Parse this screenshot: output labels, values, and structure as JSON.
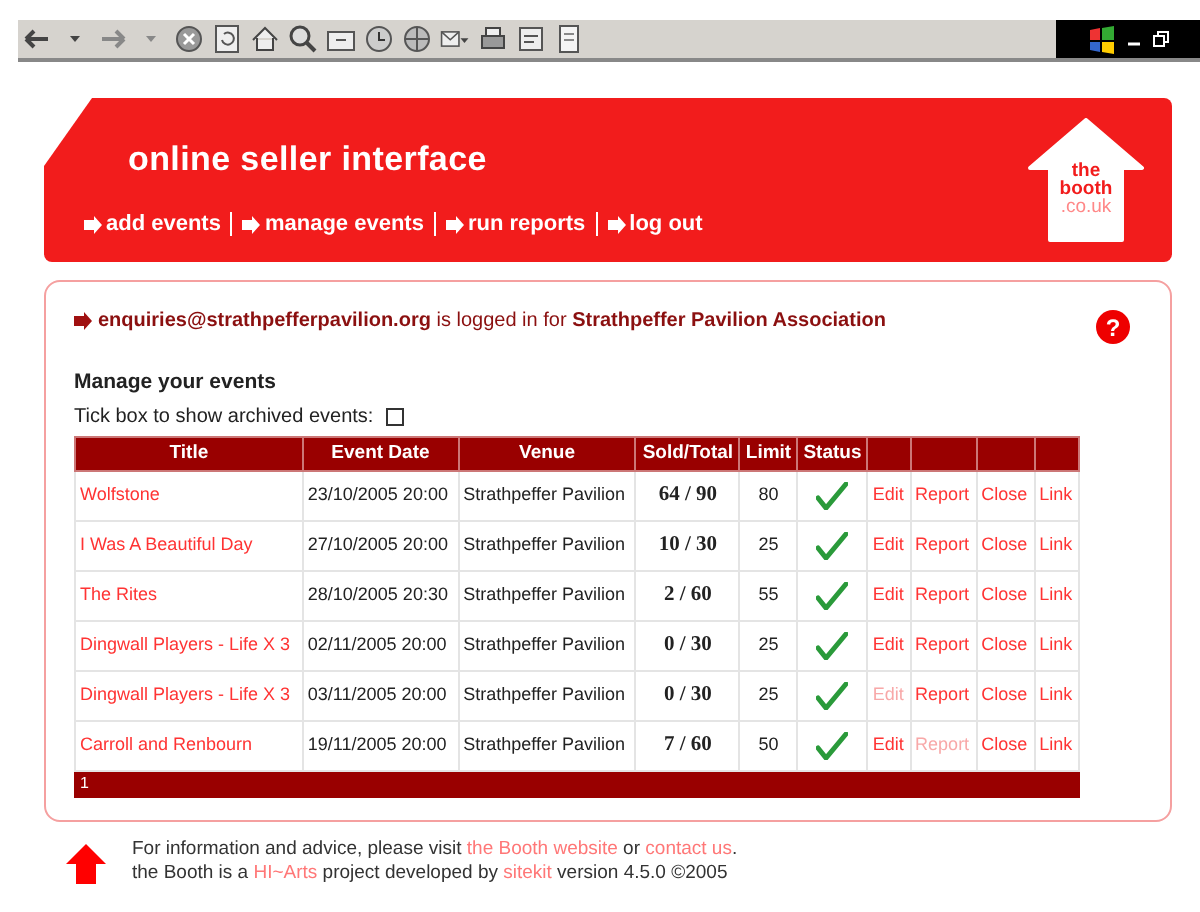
{
  "toolbar": {
    "buttons": [
      {
        "kind": "back"
      },
      {
        "kind": "back-menu"
      },
      {
        "kind": "forward"
      },
      {
        "kind": "forward-menu"
      },
      {
        "kind": "stop"
      },
      {
        "kind": "refresh"
      },
      {
        "kind": "home"
      },
      {
        "kind": "search"
      },
      {
        "kind": "favorites"
      },
      {
        "kind": "history"
      },
      {
        "kind": "media"
      },
      {
        "kind": "mail"
      },
      {
        "kind": "print"
      },
      {
        "kind": "edit"
      },
      {
        "kind": "discuss"
      }
    ]
  },
  "header": {
    "title": "online seller interface",
    "nav": [
      {
        "label": "add events"
      },
      {
        "label": "manage events"
      },
      {
        "label": "run reports"
      },
      {
        "label": "log out"
      }
    ],
    "logo": [
      "the",
      "booth",
      ".co.uk"
    ]
  },
  "login": {
    "text": "**enquiries@strathpefferpavilion.org** is logged in for **Strathpeffer Pavilion Association**",
    "help": "?"
  },
  "section": {
    "title": "Manage your events",
    "archive_label": "Tick box to show archived events:",
    "archive_checked": false
  },
  "table": {
    "columns": [
      "Title",
      "Event Date",
      "Venue",
      "Sold/Total",
      "Limit",
      "Status",
      "",
      "",
      "",
      ""
    ],
    "rows": [
      {
        "title": "Wolfstone",
        "date": "23/10/2005 20:00",
        "venue": "Strathpeffer Pavilion",
        "sold_total": "64 / 90",
        "limit": "80",
        "status_ok": true,
        "actions": [
          {
            "label": "Edit",
            "disabled": false
          },
          {
            "label": "Report",
            "disabled": false
          },
          {
            "label": "Close",
            "disabled": false
          },
          {
            "label": "Link",
            "disabled": false
          }
        ]
      },
      {
        "title": "I Was A Beautiful Day",
        "date": "27/10/2005 20:00",
        "venue": "Strathpeffer Pavilion",
        "sold_total": "10 / 30",
        "limit": "25",
        "status_ok": true,
        "actions": [
          {
            "label": "Edit",
            "disabled": false
          },
          {
            "label": "Report",
            "disabled": false
          },
          {
            "label": "Close",
            "disabled": false
          },
          {
            "label": "Link",
            "disabled": false
          }
        ]
      },
      {
        "title": "The Rites",
        "date": "28/10/2005 20:30",
        "venue": "Strathpeffer Pavilion",
        "sold_total": "2 / 60",
        "limit": "55",
        "status_ok": true,
        "actions": [
          {
            "label": "Edit",
            "disabled": false
          },
          {
            "label": "Report",
            "disabled": false
          },
          {
            "label": "Close",
            "disabled": false
          },
          {
            "label": "Link",
            "disabled": false
          }
        ]
      },
      {
        "title": "Dingwall Players - Life X 3",
        "date": "02/11/2005 20:00",
        "venue": "Strathpeffer Pavilion",
        "sold_total": "0 / 30",
        "limit": "25",
        "status_ok": true,
        "actions": [
          {
            "label": "Edit",
            "disabled": false
          },
          {
            "label": "Report",
            "disabled": false
          },
          {
            "label": "Close",
            "disabled": false
          },
          {
            "label": "Link",
            "disabled": false
          }
        ]
      },
      {
        "title": "Dingwall Players - Life X 3",
        "date": "03/11/2005 20:00",
        "venue": "Strathpeffer Pavilion",
        "sold_total": "0 / 30",
        "limit": "25",
        "status_ok": true,
        "actions": [
          {
            "label": "Edit",
            "disabled": true
          },
          {
            "label": "Report",
            "disabled": false
          },
          {
            "label": "Close",
            "disabled": false
          },
          {
            "label": "Link",
            "disabled": false
          }
        ]
      },
      {
        "title": "Carroll and Renbourn",
        "date": "19/11/2005 20:00",
        "venue": "Strathpeffer Pavilion",
        "sold_total": "7 / 60",
        "limit": "50",
        "status_ok": true,
        "actions": [
          {
            "label": "Edit",
            "disabled": false
          },
          {
            "label": "Report",
            "disabled": true
          },
          {
            "label": "Close",
            "disabled": false
          },
          {
            "label": "Link",
            "disabled": false
          }
        ]
      }
    ],
    "pager": "1"
  },
  "footer": {
    "lines": [
      [
        {
          "text": "For information and advice, please visit ",
          "link": false
        },
        {
          "text": "the Booth website",
          "link": true
        },
        {
          "text": " or ",
          "link": false
        },
        {
          "text": "contact us",
          "link": true
        },
        {
          "text": ".",
          "link": false
        }
      ],
      [
        {
          "text": "the Booth is a ",
          "link": false
        },
        {
          "text": "HI~Arts",
          "link": true
        },
        {
          "text": " project developed by ",
          "link": false
        },
        {
          "text": "sitekit",
          "link": true
        },
        {
          "text": " version 4.5.0 ©2005",
          "link": false
        }
      ]
    ]
  }
}
